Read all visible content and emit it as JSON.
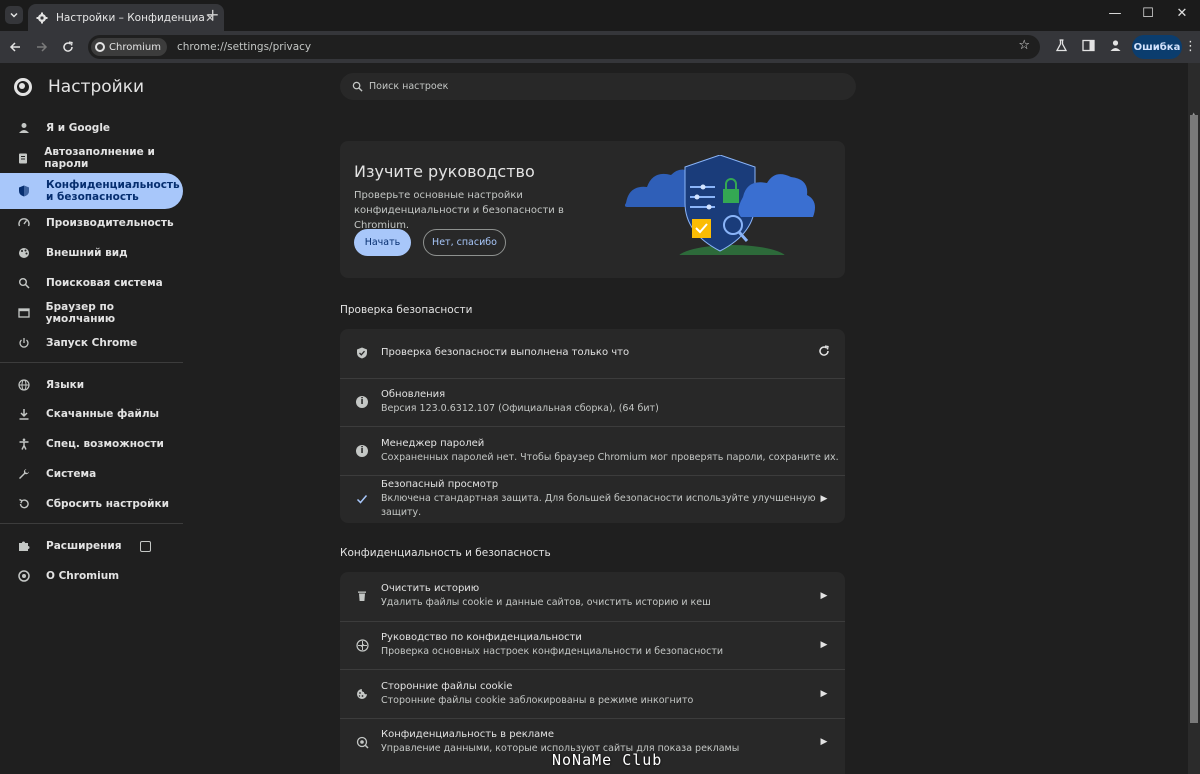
{
  "tab": {
    "title": "Настройки – Конфиденциальн",
    "close": "✕",
    "new_tab": "+"
  },
  "window": {
    "minimize": "—",
    "maximize": "☐",
    "close": "✕"
  },
  "omnibox": {
    "chip_label": "Chromium",
    "url": "chrome://settings/privacy"
  },
  "toolbar": {
    "error_label": "Ошибка"
  },
  "sidebar": {
    "title": "Настройки",
    "items": [
      {
        "label": "Я и Google",
        "icon": "person-icon"
      },
      {
        "label": "Автозаполнение и пароли",
        "icon": "clipboard-icon"
      },
      {
        "label": "Конфиденциальность и безопасность",
        "icon": "shield-icon"
      },
      {
        "label": "Производительность",
        "icon": "speedometer-icon"
      },
      {
        "label": "Внешний вид",
        "icon": "palette-icon"
      },
      {
        "label": "Поисковая система",
        "icon": "search-icon"
      },
      {
        "label": "Браузер по умолчанию",
        "icon": "browser-icon"
      },
      {
        "label": "Запуск Chrome",
        "icon": "power-icon"
      },
      {
        "label": "Языки",
        "icon": "globe-icon"
      },
      {
        "label": "Скачанные файлы",
        "icon": "download-icon"
      },
      {
        "label": "Спец. возможности",
        "icon": "accessibility-icon"
      },
      {
        "label": "Система",
        "icon": "wrench-icon"
      },
      {
        "label": "Сбросить настройки",
        "icon": "reset-icon"
      },
      {
        "label": "Расширения",
        "icon": "puzzle-icon"
      },
      {
        "label": "О Chromium",
        "icon": "chromium-icon"
      }
    ]
  },
  "search": {
    "placeholder": "Поиск настроек"
  },
  "promo": {
    "title": "Изучите руководство",
    "text": "Проверьте основные настройки конфиденциальности и безопасности в Chromium.",
    "start": "Начать",
    "no_thanks": "Нет, спасибо"
  },
  "safety_check": {
    "title": "Проверка безопасности",
    "rows": [
      {
        "t1": "Проверка безопасности выполнена только что",
        "t2": ""
      },
      {
        "t1": "Обновления",
        "t2": "Версия 123.0.6312.107 (Официальная сборка), (64 бит)"
      },
      {
        "t1": "Менеджер паролей",
        "t2": "Сохраненных паролей нет. Чтобы браузер Chromium мог проверять пароли, сохраните их."
      },
      {
        "t1": "Безопасный просмотр",
        "t2": "Включена стандартная защита. Для большей безопасности используйте улучшенную защиту."
      }
    ]
  },
  "privacy": {
    "title": "Конфиденциальность и безопасность",
    "rows": [
      {
        "t1": "Очистить историю",
        "t2": "Удалить файлы cookie и данные сайтов, очистить историю и кеш"
      },
      {
        "t1": "Руководство по конфиденциальности",
        "t2": "Проверка основных настроек конфиденциальности и безопасности"
      },
      {
        "t1": "Сторонние файлы cookie",
        "t2": "Сторонние файлы cookie заблокированы в режиме инкогнито"
      },
      {
        "t1": "Конфиденциальность в рекламе",
        "t2": "Управление данными, которые используют сайты для показа рекламы"
      }
    ]
  },
  "watermark": "NoNaMe Club",
  "colors": {
    "accent": "#a8c7fa",
    "accent_text": "#062e6f",
    "background": "#1f1f1f",
    "card": "#282828"
  }
}
